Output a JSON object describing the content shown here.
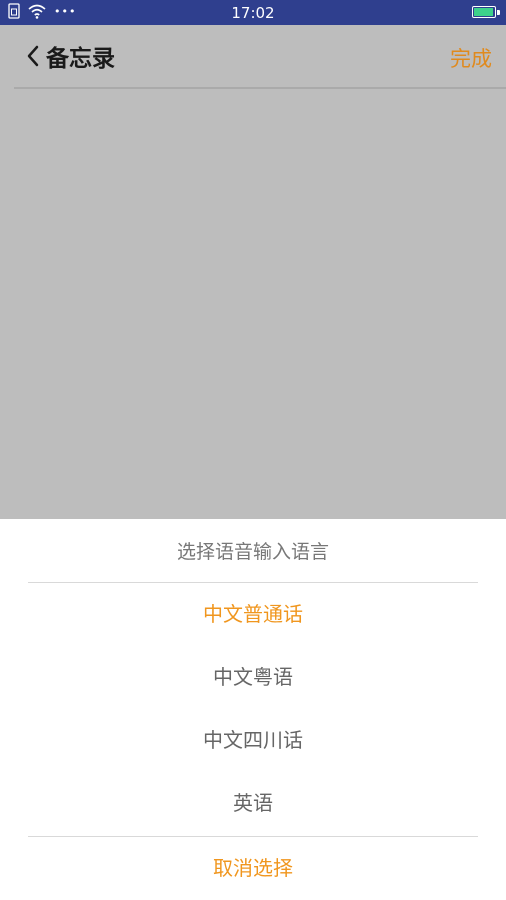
{
  "status_bar": {
    "time": "17:02",
    "icons": [
      "sim-icon",
      "wifi-icon",
      "more-dots-icon",
      "battery-charging-icon"
    ],
    "dots": "•••",
    "battery_level": 1.0
  },
  "header": {
    "title": "备忘录",
    "done_label": "完成"
  },
  "sheet": {
    "title": "选择语音输入语言",
    "options": [
      {
        "label": "中文普通话",
        "selected": true
      },
      {
        "label": "中文粤语",
        "selected": false
      },
      {
        "label": "中文四川话",
        "selected": false
      },
      {
        "label": "英语",
        "selected": false
      }
    ],
    "cancel_label": "取消选择"
  },
  "colors": {
    "status_bar_bg": "#2f3f8e",
    "accent": "#f0961e",
    "overlay_bg": "#bdbdbd",
    "battery_fill": "#3dd18b"
  }
}
